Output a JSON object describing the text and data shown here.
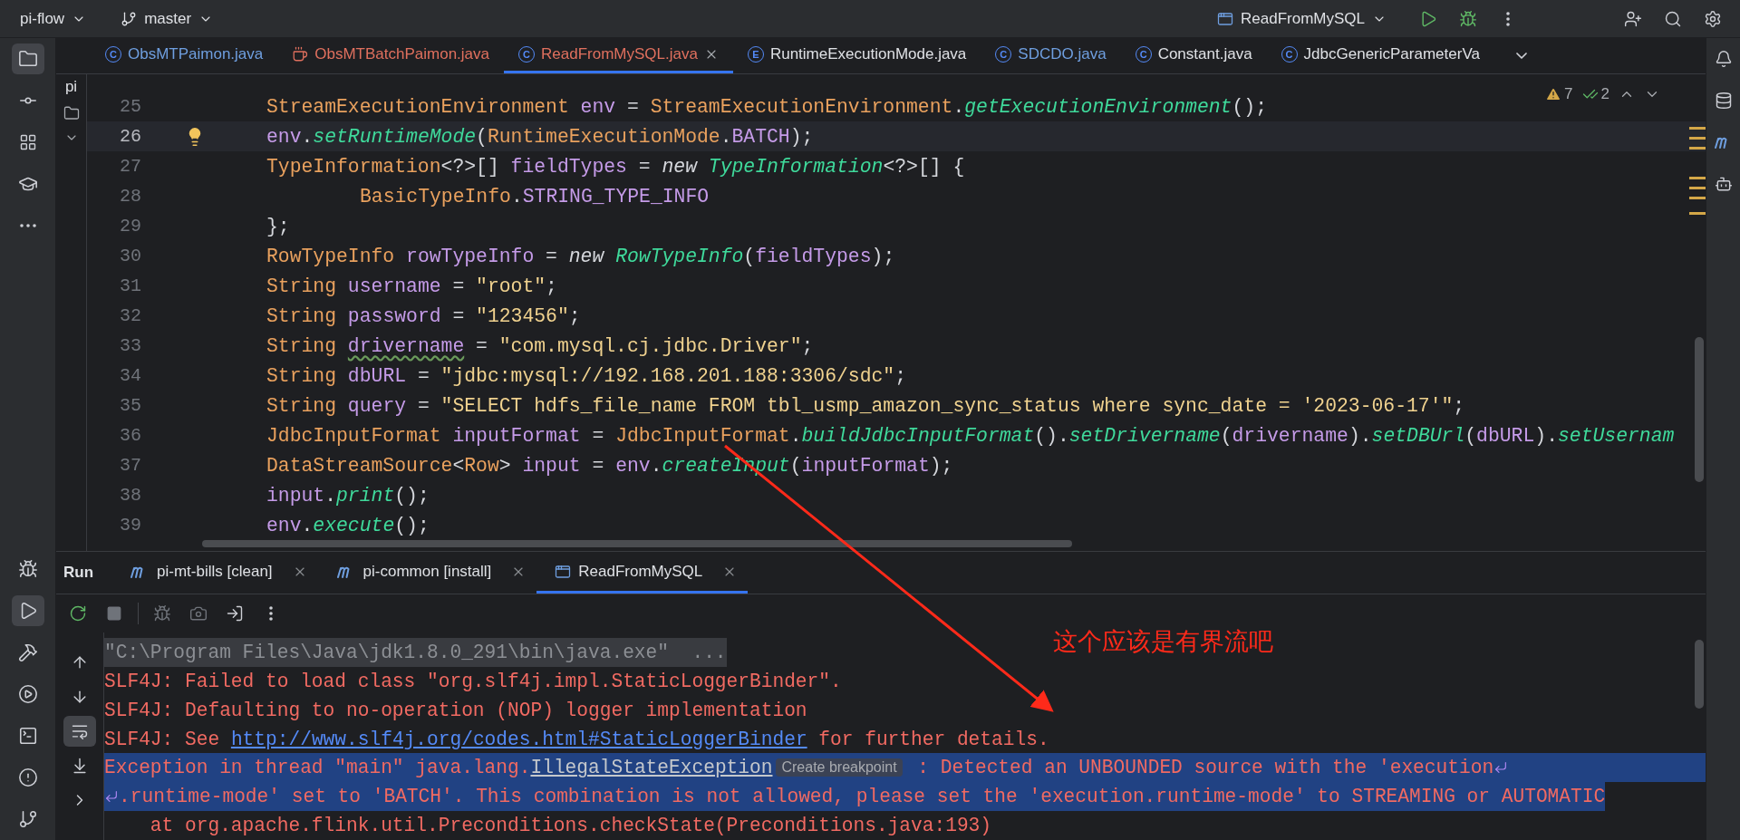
{
  "top_bar": {
    "project": "pi-flow",
    "branch": "master",
    "run_config": "ReadFromMySQL"
  },
  "project_panel": {
    "label": "pi"
  },
  "editor_tabs": [
    {
      "label": "ObsMTPaimon.java",
      "kind": "class",
      "letter": "C",
      "color": "#6f9fe0",
      "selected": false
    },
    {
      "label": "ObsMTBatchPaimon.java",
      "kind": "file",
      "color": "#e0705e",
      "selected": false
    },
    {
      "label": "ReadFromMySQL.java",
      "kind": "class",
      "letter": "C",
      "color": "#e0705e",
      "selected": true
    },
    {
      "label": "RuntimeExecutionMode.java",
      "kind": "class",
      "letter": "E",
      "color": "#dfe1e5",
      "selected": false
    },
    {
      "label": "SDCDO.java",
      "kind": "class",
      "letter": "C",
      "color": "#6f9fe0",
      "selected": false
    },
    {
      "label": "Constant.java",
      "kind": "class",
      "letter": "C",
      "color": "#dfe1e5",
      "selected": false
    },
    {
      "label": "JdbcGenericParameterVa",
      "kind": "class",
      "letter": "C",
      "color": "#dfe1e5",
      "selected": false
    }
  ],
  "problems": {
    "warnings": "7",
    "weak_warnings": "2"
  },
  "code_lines": [
    {
      "number": "25",
      "current": false,
      "indented": false,
      "tokens": [
        {
          "kind": "type",
          "text": "StreamExecutionEnvironment"
        },
        {
          "kind": "var",
          "text": " env"
        },
        {
          "kind": "op",
          "text": " = "
        },
        {
          "kind": "type",
          "text": "StreamExecutionEnvironment"
        },
        {
          "kind": "op",
          "text": "."
        },
        {
          "kind": "method",
          "text": "getExecutionEnvironment"
        },
        {
          "kind": "op",
          "text": "();"
        }
      ]
    },
    {
      "number": "26",
      "current": true,
      "indented": false,
      "tokens": [
        {
          "kind": "var",
          "text": "env"
        },
        {
          "kind": "op",
          "text": "."
        },
        {
          "kind": "method",
          "text": "setRuntimeMode"
        },
        {
          "kind": "op",
          "text": "("
        },
        {
          "kind": "type",
          "text": "RuntimeExecutionMode"
        },
        {
          "kind": "op",
          "text": "."
        },
        {
          "kind": "const",
          "text": "BATCH"
        },
        {
          "kind": "op",
          "text": ");"
        }
      ]
    },
    {
      "number": "27",
      "current": false,
      "indented": false,
      "tokens": [
        {
          "kind": "type",
          "text": "TypeInformation"
        },
        {
          "kind": "op",
          "text": "<?>[] "
        },
        {
          "kind": "var",
          "text": "fieldTypes"
        },
        {
          "kind": "op",
          "text": " = "
        },
        {
          "kind": "keyword",
          "text": "new "
        },
        {
          "kind": "method",
          "text": "TypeInformation"
        },
        {
          "kind": "op",
          "text": "<?>[] {"
        }
      ]
    },
    {
      "number": "28",
      "current": false,
      "indented": true,
      "tokens": [
        {
          "kind": "type",
          "text": "BasicTypeInfo"
        },
        {
          "kind": "op",
          "text": "."
        },
        {
          "kind": "const",
          "text": "STRING_TYPE_INFO"
        }
      ]
    },
    {
      "number": "29",
      "current": false,
      "indented": false,
      "tokens": [
        {
          "kind": "op",
          "text": "};"
        }
      ]
    },
    {
      "number": "30",
      "current": false,
      "indented": false,
      "tokens": [
        {
          "kind": "type",
          "text": "RowTypeInfo"
        },
        {
          "kind": "var",
          "text": " rowTypeInfo"
        },
        {
          "kind": "op",
          "text": " = "
        },
        {
          "kind": "keyword",
          "text": "new "
        },
        {
          "kind": "method",
          "text": "RowTypeInfo"
        },
        {
          "kind": "op",
          "text": "("
        },
        {
          "kind": "var",
          "text": "fieldTypes"
        },
        {
          "kind": "op",
          "text": ");"
        }
      ]
    },
    {
      "number": "31",
      "current": false,
      "indented": false,
      "tokens": [
        {
          "kind": "type",
          "text": "String"
        },
        {
          "kind": "var",
          "text": " username"
        },
        {
          "kind": "op",
          "text": " = "
        },
        {
          "kind": "string",
          "text": "\"root\""
        },
        {
          "kind": "op",
          "text": ";"
        }
      ]
    },
    {
      "number": "32",
      "current": false,
      "indented": false,
      "tokens": [
        {
          "kind": "type",
          "text": "String"
        },
        {
          "kind": "var",
          "text": " password"
        },
        {
          "kind": "op",
          "text": " = "
        },
        {
          "kind": "string",
          "text": "\"123456\""
        },
        {
          "kind": "op",
          "text": ";"
        }
      ]
    },
    {
      "number": "33",
      "current": false,
      "indented": false,
      "tokens": [
        {
          "kind": "type",
          "text": "String "
        },
        {
          "kind": "warn",
          "text": "drivername"
        },
        {
          "kind": "op",
          "text": " = "
        },
        {
          "kind": "string",
          "text": "\"com.mysql.cj.jdbc.Driver\""
        },
        {
          "kind": "op",
          "text": ";"
        }
      ]
    },
    {
      "number": "34",
      "current": false,
      "indented": false,
      "tokens": [
        {
          "kind": "type",
          "text": "String"
        },
        {
          "kind": "var",
          "text": " dbURL"
        },
        {
          "kind": "op",
          "text": " = "
        },
        {
          "kind": "string",
          "text": "\"jdbc:mysql://192.168.201.188:3306/sdc\""
        },
        {
          "kind": "op",
          "text": ";"
        }
      ]
    },
    {
      "number": "35",
      "current": false,
      "indented": false,
      "tokens": [
        {
          "kind": "type",
          "text": "String"
        },
        {
          "kind": "var",
          "text": " query"
        },
        {
          "kind": "op",
          "text": " = "
        },
        {
          "kind": "string",
          "text": "\"SELECT hdfs_file_name FROM tbl_usmp_amazon_sync_status where sync_date = '2023-06-17'\""
        },
        {
          "kind": "op",
          "text": ";"
        }
      ]
    },
    {
      "number": "36",
      "current": false,
      "indented": false,
      "tokens": [
        {
          "kind": "type",
          "text": "JdbcInputFormat"
        },
        {
          "kind": "var",
          "text": " inputFormat"
        },
        {
          "kind": "op",
          "text": " = "
        },
        {
          "kind": "type",
          "text": "JdbcInputFormat"
        },
        {
          "kind": "op",
          "text": "."
        },
        {
          "kind": "method",
          "text": "buildJdbcInputFormat"
        },
        {
          "kind": "op",
          "text": "()."
        },
        {
          "kind": "method",
          "text": "setDrivername"
        },
        {
          "kind": "op",
          "text": "("
        },
        {
          "kind": "var",
          "text": "drivername"
        },
        {
          "kind": "op",
          "text": ")."
        },
        {
          "kind": "method",
          "text": "setDBUrl"
        },
        {
          "kind": "op",
          "text": "("
        },
        {
          "kind": "var",
          "text": "dbURL"
        },
        {
          "kind": "op",
          "text": ")."
        },
        {
          "kind": "method",
          "text": "setUsernam"
        }
      ]
    },
    {
      "number": "37",
      "current": false,
      "indented": false,
      "tokens": [
        {
          "kind": "type",
          "text": "DataStreamSource"
        },
        {
          "kind": "op",
          "text": "<"
        },
        {
          "kind": "type",
          "text": "Row"
        },
        {
          "kind": "op",
          "text": ">"
        },
        {
          "kind": "var",
          "text": " input"
        },
        {
          "kind": "op",
          "text": " = "
        },
        {
          "kind": "var",
          "text": "env"
        },
        {
          "kind": "op",
          "text": "."
        },
        {
          "kind": "method",
          "text": "createInput"
        },
        {
          "kind": "op",
          "text": "("
        },
        {
          "kind": "var",
          "text": "inputFormat"
        },
        {
          "kind": "op",
          "text": ");"
        }
      ]
    },
    {
      "number": "38",
      "current": false,
      "indented": false,
      "tokens": [
        {
          "kind": "var",
          "text": "input"
        },
        {
          "kind": "op",
          "text": "."
        },
        {
          "kind": "method",
          "text": "print"
        },
        {
          "kind": "op",
          "text": "();"
        }
      ]
    },
    {
      "number": "39",
      "current": false,
      "indented": false,
      "tokens": [
        {
          "kind": "var",
          "text": "env"
        },
        {
          "kind": "op",
          "text": "."
        },
        {
          "kind": "method",
          "text": "execute"
        },
        {
          "kind": "op",
          "text": "();"
        }
      ]
    }
  ],
  "run_panel": {
    "title": "Run",
    "tabs": [
      {
        "label": "pi-mt-bills [clean]",
        "kind": "maven",
        "selected": false
      },
      {
        "label": "pi-common [install]",
        "kind": "maven",
        "selected": false
      },
      {
        "label": "ReadFromMySQL",
        "kind": "app",
        "selected": true
      }
    ]
  },
  "console_lines": [
    {
      "kind": "command",
      "selected": false,
      "wrap_end": false,
      "wrap_start": false,
      "segments": [
        {
          "kind": "text",
          "text": "\"C:\\Program Files\\Java\\jdk1.8.0_291\\bin\\java.exe\"  ..."
        }
      ]
    },
    {
      "kind": "error",
      "selected": false,
      "wrap_end": false,
      "wrap_start": false,
      "segments": [
        {
          "kind": "text",
          "text": "SLF4J: Failed to load class \"org.slf4j.impl.StaticLoggerBinder\"."
        }
      ]
    },
    {
      "kind": "error",
      "selected": false,
      "wrap_end": false,
      "wrap_start": false,
      "segments": [
        {
          "kind": "text",
          "text": "SLF4J: Defaulting to no-operation (NOP) logger implementation"
        }
      ]
    },
    {
      "kind": "error",
      "selected": false,
      "wrap_end": false,
      "wrap_start": false,
      "segments": [
        {
          "kind": "text",
          "text": "SLF4J: See "
        },
        {
          "kind": "link",
          "text": "http://www.slf4j.org/codes.html#StaticLoggerBinder"
        },
        {
          "kind": "text",
          "text": " for further details."
        }
      ]
    },
    {
      "kind": "error",
      "selected": true,
      "wrap_end": true,
      "wrap_start": false,
      "segments": [
        {
          "kind": "text",
          "text": "Exception in thread \"main\" java.lang."
        },
        {
          "kind": "exception",
          "text": "IllegalStateException"
        },
        {
          "kind": "badge",
          "text": "Create breakpoint"
        },
        {
          "kind": "text",
          "text": " : Detected an UNBOUNDED source with the 'execution"
        }
      ]
    },
    {
      "kind": "error",
      "selected": true,
      "wrap_end": false,
      "wrap_start": true,
      "segments": [
        {
          "kind": "text",
          "text": ".runtime-mode' set to 'BATCH'. This combination is not allowed, please set the 'execution.runtime-mode' to STREAMING or AUTOMATIC"
        }
      ]
    },
    {
      "kind": "error",
      "selected": false,
      "wrap_end": false,
      "wrap_start": false,
      "segments": [
        {
          "kind": "text",
          "text": "    at org.apache.flink.util.Preconditions.checkState(Preconditions.java:193)"
        }
      ]
    }
  ],
  "annotation": {
    "text": "这个应该是有界流吧"
  }
}
